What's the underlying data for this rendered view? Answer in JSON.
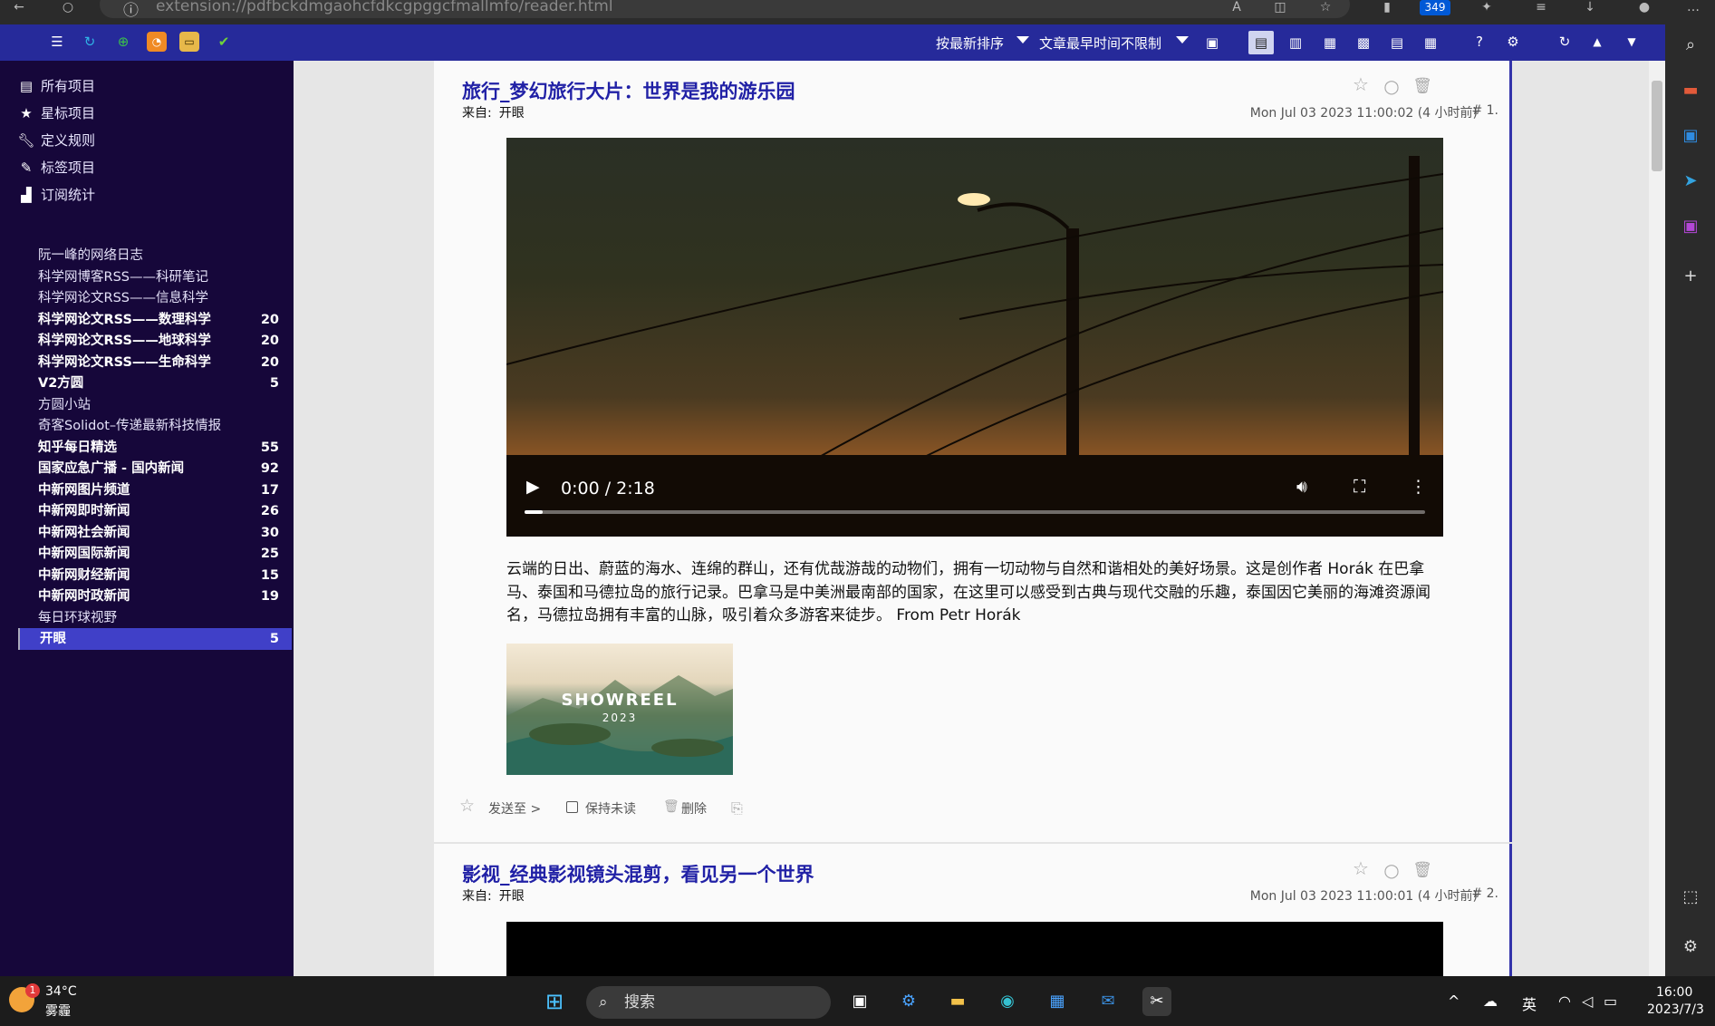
{
  "browser": {
    "url": "extension://pdfbckdmgaohcfdkcgpggcfmallmfo/reader.html",
    "badge": "349"
  },
  "toolbar": {
    "sort_label": "按最新排序",
    "time_label": "文章最早时间不限制"
  },
  "nav": {
    "items": [
      {
        "label": "所有项目",
        "icon": "list-icon"
      },
      {
        "label": "星标项目",
        "icon": "star-icon"
      },
      {
        "label": "定义规则",
        "icon": "wrench-icon"
      },
      {
        "label": "标签项目",
        "icon": "pencil-icon"
      },
      {
        "label": "订阅统计",
        "icon": "bar-chart-icon"
      }
    ],
    "feeds": [
      {
        "name": "阮一峰的网络日志",
        "count": ""
      },
      {
        "name": "科学网博客RSS——科研笔记",
        "count": ""
      },
      {
        "name": "科学网论文RSS——信息科学",
        "count": ""
      },
      {
        "name": "科学网论文RSS——数理科学",
        "count": "20"
      },
      {
        "name": "科学网论文RSS——地球科学",
        "count": "20"
      },
      {
        "name": "科学网论文RSS——生命科学",
        "count": "20"
      },
      {
        "name": "V2方圆",
        "count": "5"
      },
      {
        "name": "方圆小站",
        "count": ""
      },
      {
        "name": "奇客Solidot–传递最新科技情报",
        "count": ""
      },
      {
        "name": "知乎每日精选",
        "count": "55"
      },
      {
        "name": "国家应急广播 - 国内新闻",
        "count": "92"
      },
      {
        "name": "中新网图片频道",
        "count": "17"
      },
      {
        "name": "中新网即时新闻",
        "count": "26"
      },
      {
        "name": "中新网社会新闻",
        "count": "30"
      },
      {
        "name": "中新网国际新闻",
        "count": "25"
      },
      {
        "name": "中新网财经新闻",
        "count": "15"
      },
      {
        "name": "中新网时政新闻",
        "count": "19"
      },
      {
        "name": "每日环球视野",
        "count": ""
      },
      {
        "name": "开眼",
        "count": "5"
      }
    ]
  },
  "articles": [
    {
      "title": "旅行_梦幻旅行大片：世界是我的游乐园",
      "source_label": "来自:",
      "source": "开眼",
      "date": "Mon Jul 03 2023 11:00:02 (4 小时前)",
      "number": "# 1.",
      "video_time": "0:00 / 2:18",
      "video_progress": 0.02,
      "description": "云端的日出、蔚蓝的海水、连绵的群山，还有优哉游哉的动物们，拥有一切动物与自然和谐相处的美好场景。这是创作者 Horák 在巴拿马、泰国和马德拉岛的旅行记录。巴拿马是中美洲最南部的国家，在这里可以感受到古典与现代交融的乐趣，泰国因它美丽的海滩资源闻名，马德拉岛拥有丰富的山脉，吸引着众多游客来徒步。 From Petr Horák",
      "thumb_title": "SHOWREEL",
      "thumb_year": "2023",
      "actions": {
        "send": "发送至 >",
        "keep_unread": "保持未读",
        "delete": "删除"
      }
    },
    {
      "title": "影视_经典影视镜头混剪，看见另一个世界",
      "source_label": "来自:",
      "source": "开眼",
      "date": "Mon Jul 03 2023 11:00:01 (4 小时前)",
      "number": "# 2."
    }
  ],
  "taskbar": {
    "temperature": "34°C",
    "weather": "雾霾",
    "weather_badge": "1",
    "search_placeholder": "搜索",
    "ime": "英",
    "time": "16:00",
    "date": "2023/7/3"
  }
}
